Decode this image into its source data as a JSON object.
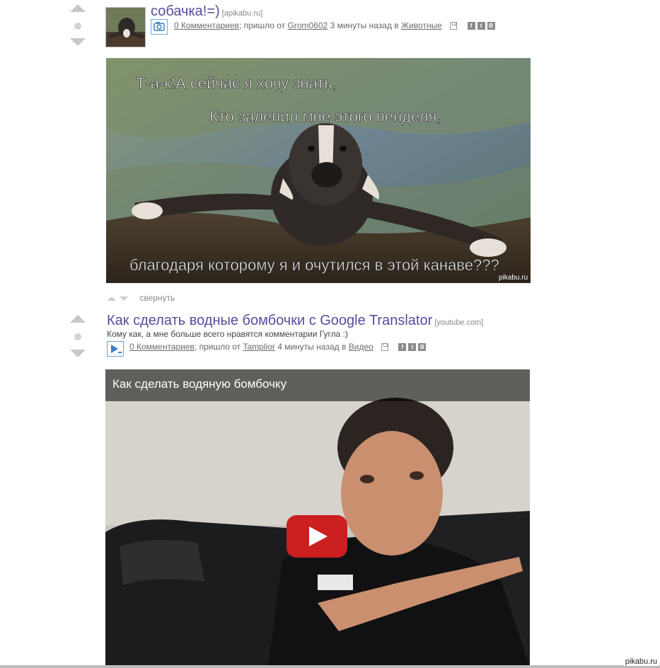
{
  "posts": [
    {
      "title": "собачка!=)",
      "source": "[apikabu.ru]",
      "comments": "0 Комментариев",
      "from_text": "; пришло от",
      "author": "Grom0602",
      "time_text": "3 минуты назад в",
      "category": "Животные",
      "image_text": {
        "line1": "Т-а-к!А сейчас я хочу знать,",
        "line2": "Кто залепил мне этого пенделя,",
        "line3": "благодаря которому я и очутился в этой канаве???",
        "watermark": "pikabu.ru"
      },
      "collapse_label": "свернуть"
    },
    {
      "title": "Как сделать водные бомбочки с Google Translator",
      "source": "[youtube.com]",
      "description": "Кому как, а мне больше всего нравятся комментарии Гугла :)",
      "comments": "0 Комментариев",
      "from_text": "; пришло от",
      "author": "Tamplior",
      "time_text": "4 минуты назад в",
      "category": "Видео",
      "video_title": "Как сделать водяную бомбочку"
    }
  ],
  "share_icons": [
    "f",
    "t",
    "B"
  ],
  "footer_watermark": "pikabu.ru",
  "colors": {
    "title": "#5b4a9e",
    "vote_arrow": "#c8c8c8",
    "youtube_red": "#cc1f1f"
  }
}
